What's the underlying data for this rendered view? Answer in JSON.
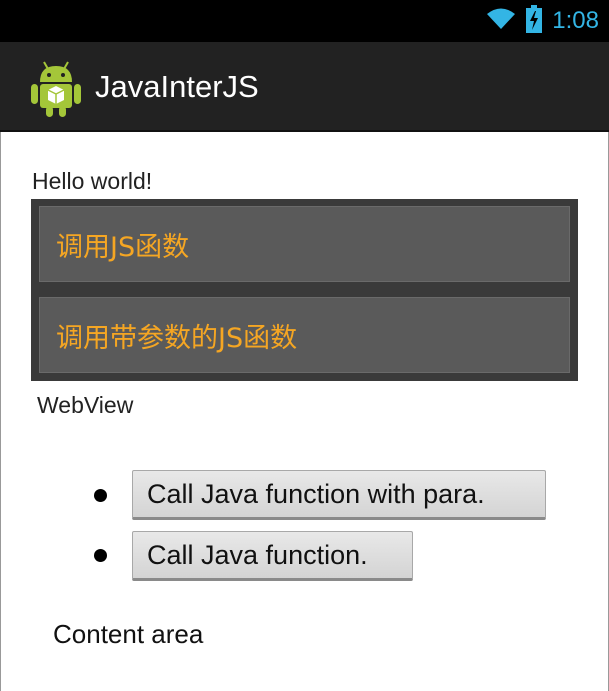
{
  "status_bar": {
    "time": "1:08"
  },
  "action_bar": {
    "title": "JavaInterJS"
  },
  "main": {
    "hello_text": "Hello world!",
    "buttons": [
      {
        "label": "调用JS函数"
      },
      {
        "label": "调用带参数的JS函数"
      }
    ],
    "webview_label": "WebView"
  },
  "webview": {
    "buttons": [
      {
        "label": "Call Java function with para."
      },
      {
        "label": "Call Java function."
      }
    ],
    "content_text": "Content area"
  },
  "colors": {
    "status_time": "#33b5e5",
    "button_text": "#f5a623",
    "action_bar_bg": "#222222"
  }
}
